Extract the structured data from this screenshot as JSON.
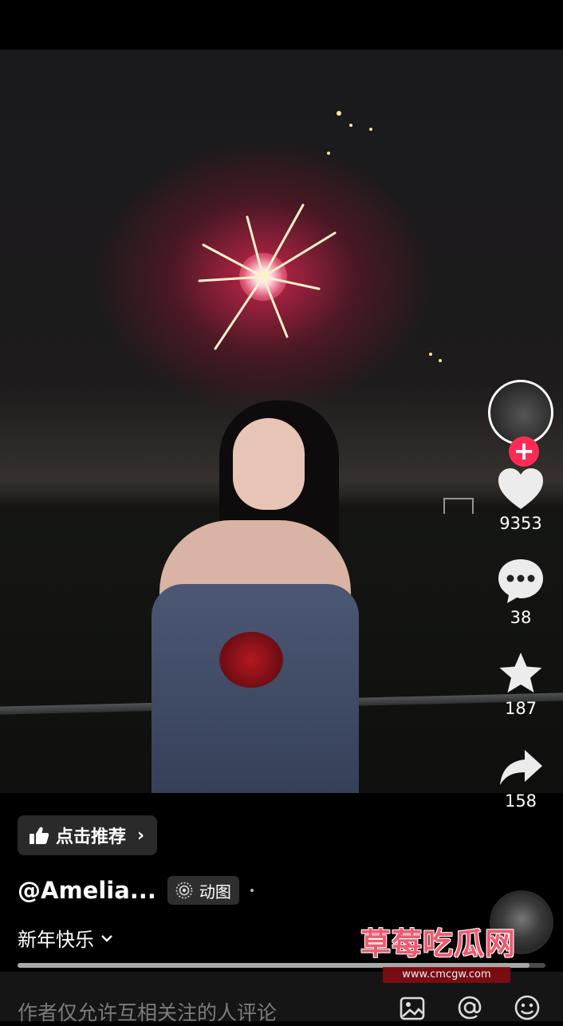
{
  "video": {
    "progress": 0.97
  },
  "recommend_chip": {
    "label": "点击推荐"
  },
  "author": {
    "name": "@Amelia...",
    "tag": "动图"
  },
  "caption": {
    "text": "新年快乐"
  },
  "comment_bar": {
    "hint": "作者仅允许互相关注的人评论"
  },
  "actions": {
    "likes": "9353",
    "comments": "38",
    "favorites": "187",
    "shares": "158"
  },
  "follow": {
    "symbol": "+"
  },
  "watermark": {
    "text": "草莓吃瓜网",
    "url": "www.cmcgw.com"
  },
  "colors": {
    "follow_red": "#fe2c55",
    "progress": "#a8a8a8",
    "background": "#000000"
  }
}
